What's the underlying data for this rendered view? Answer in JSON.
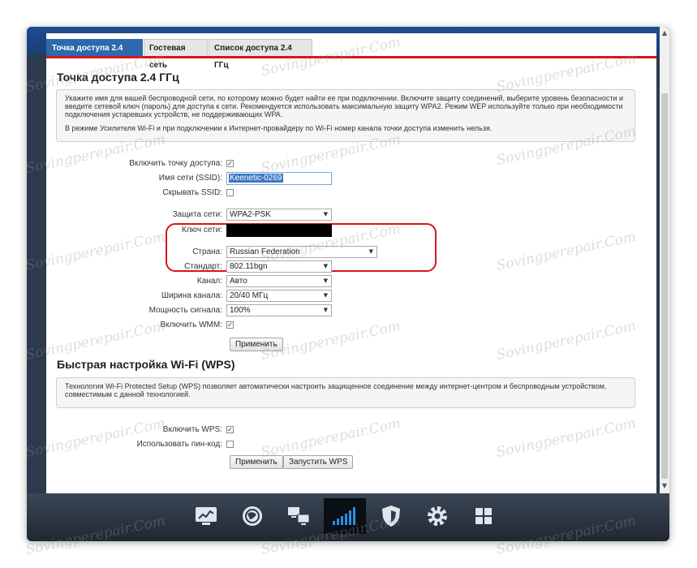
{
  "tabs": [
    {
      "label": "Точка доступа 2.4 ГГц",
      "active": true
    },
    {
      "label": "Гостевая сеть",
      "active": false
    },
    {
      "label": "Список доступа 2.4 ГГц",
      "active": false
    }
  ],
  "section1": {
    "title": "Точка доступа 2.4 ГГц",
    "info_p1": "Укажите имя для вашей беспроводной сети, по которому можно будет найти ее при подключении. Включите защиту соединений, выберите уровень безопасности и введите сетевой ключ (пароль) для доступа к сети. Рекомендуется использовать максимальную защиту WPA2. Режим WEP используйте только при необходимости подключения устаревших устройств, не поддерживающих WPA.",
    "info_p2": "В режиме Усилителя Wi-Fi и при подключении к Интернет-провайдеру по Wi-Fi номер канала точки доступа изменить нельзя."
  },
  "form": {
    "enable_ap_label": "Включить точку доступа:",
    "enable_ap_checked": true,
    "ssid_label": "Имя сети (SSID):",
    "ssid_value": "Keenetic-0269",
    "hide_ssid_label": "Скрывать SSID:",
    "hide_ssid_checked": false,
    "security_label": "Защита сети:",
    "security_value": "WPA2-PSK",
    "key_label": "Ключ сети:",
    "country_label": "Страна:",
    "country_value": "Russian Federation",
    "standard_label": "Стандарт:",
    "standard_value": "802.11bgn",
    "channel_label": "Канал:",
    "channel_value": "Авто",
    "width_label": "Ширина канала:",
    "width_value": "20/40 МГц",
    "power_label": "Мощность сигнала:",
    "power_value": "100%",
    "wmm_label": "Включить WMM:",
    "wmm_checked": true,
    "apply_button": "Применить"
  },
  "wps": {
    "title": "Быстрая настройка Wi-Fi (WPS)",
    "info": "Технология Wi-Fi Protected Setup (WPS) позволяет автоматически настроить защищенное соединение между интернет-центром и беспроводным устройством, совместимым с данной технологией.",
    "enable_label": "Включить WPS:",
    "enable_checked": true,
    "pin_label": "Использовать пин-код:",
    "pin_checked": false,
    "apply_button": "Применить",
    "start_button": "Запустить WPS"
  },
  "watermark": "Sovingperepair.Com",
  "taskbar": {
    "icons": [
      "monitor-icon",
      "globe-icon",
      "network-icon",
      "wifi-signal-icon",
      "shield-icon",
      "gear-icon",
      "apps-icon"
    ],
    "active_index": 3
  },
  "colors": {
    "accent_red": "#d8141c",
    "tab_active": "#2c69ad",
    "frame_blue": "#1f4d8e",
    "taskbar": "#2b3340"
  }
}
